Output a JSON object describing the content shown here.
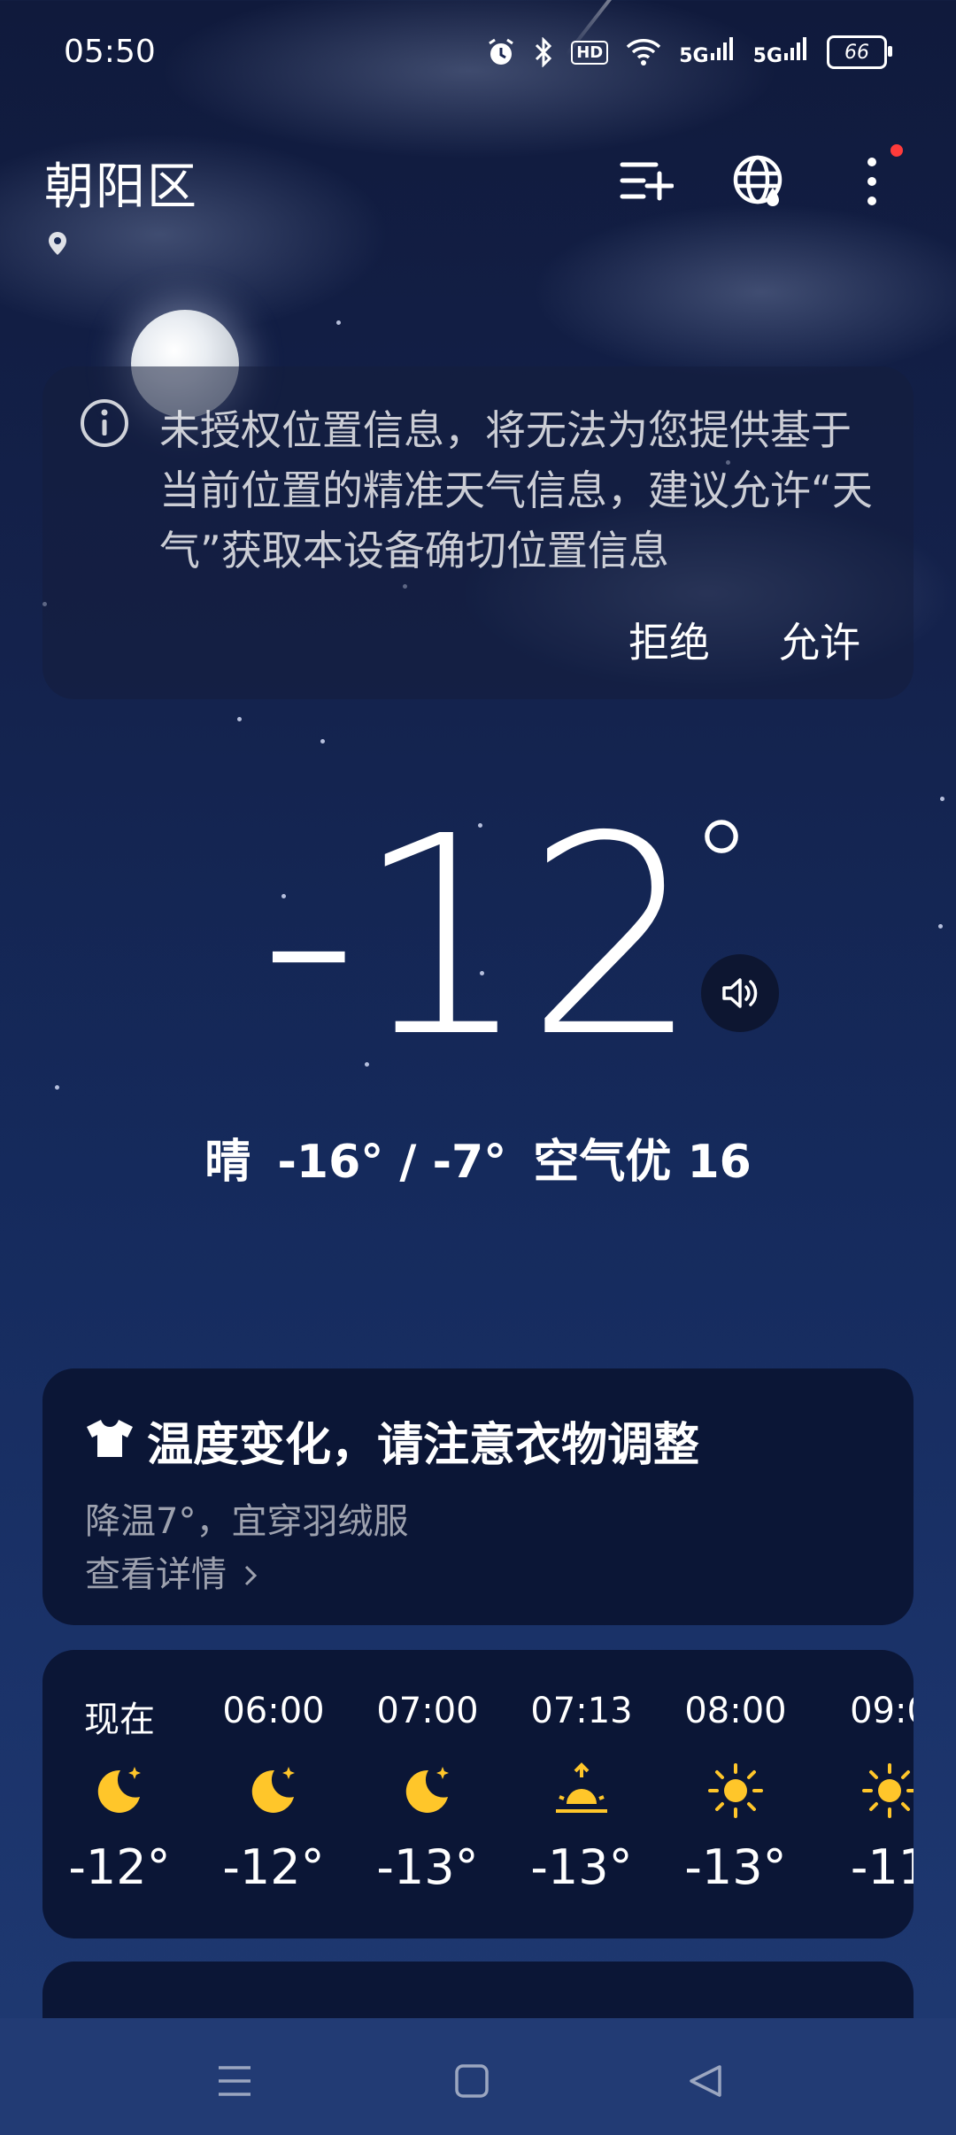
{
  "status_bar": {
    "time": "05:50",
    "hd_label": "HD",
    "net1": "5G",
    "net2": "5G",
    "battery": "66"
  },
  "header": {
    "title": "朝阳区",
    "icons": [
      "add-city-icon",
      "globe-icon",
      "more-icon"
    ]
  },
  "permission_card": {
    "message": "未授权位置信息，将无法为您提供基于当前位置的精准天气信息，建议允许“天气”获取本设备确切位置信息",
    "deny_label": "拒绝",
    "allow_label": "允许"
  },
  "current": {
    "temperature": "-12",
    "degree": "°",
    "condition": "晴",
    "range": "-16° / -7°",
    "aqi": "空气优 16"
  },
  "tip": {
    "title": "温度变化，请注意衣物调整",
    "subtitle": "降温7°，宜穿羽绒服",
    "link": "查看详情"
  },
  "hourly": [
    {
      "time": "现在",
      "icon": "moon-icon",
      "temp": "-12°"
    },
    {
      "time": "06:00",
      "icon": "moon-icon",
      "temp": "-12°"
    },
    {
      "time": "07:00",
      "icon": "moon-icon",
      "temp": "-13°"
    },
    {
      "time": "07:13",
      "icon": "sunrise-icon",
      "temp": "-13°"
    },
    {
      "time": "08:00",
      "icon": "sun-icon",
      "temp": "-13°"
    },
    {
      "time": "09:0",
      "icon": "sun-icon",
      "temp": "-11"
    }
  ],
  "colors": {
    "accent_yellow": "#ffc62a",
    "card_bg": "#0b1636",
    "notification_dot": "#ff3b3b"
  }
}
